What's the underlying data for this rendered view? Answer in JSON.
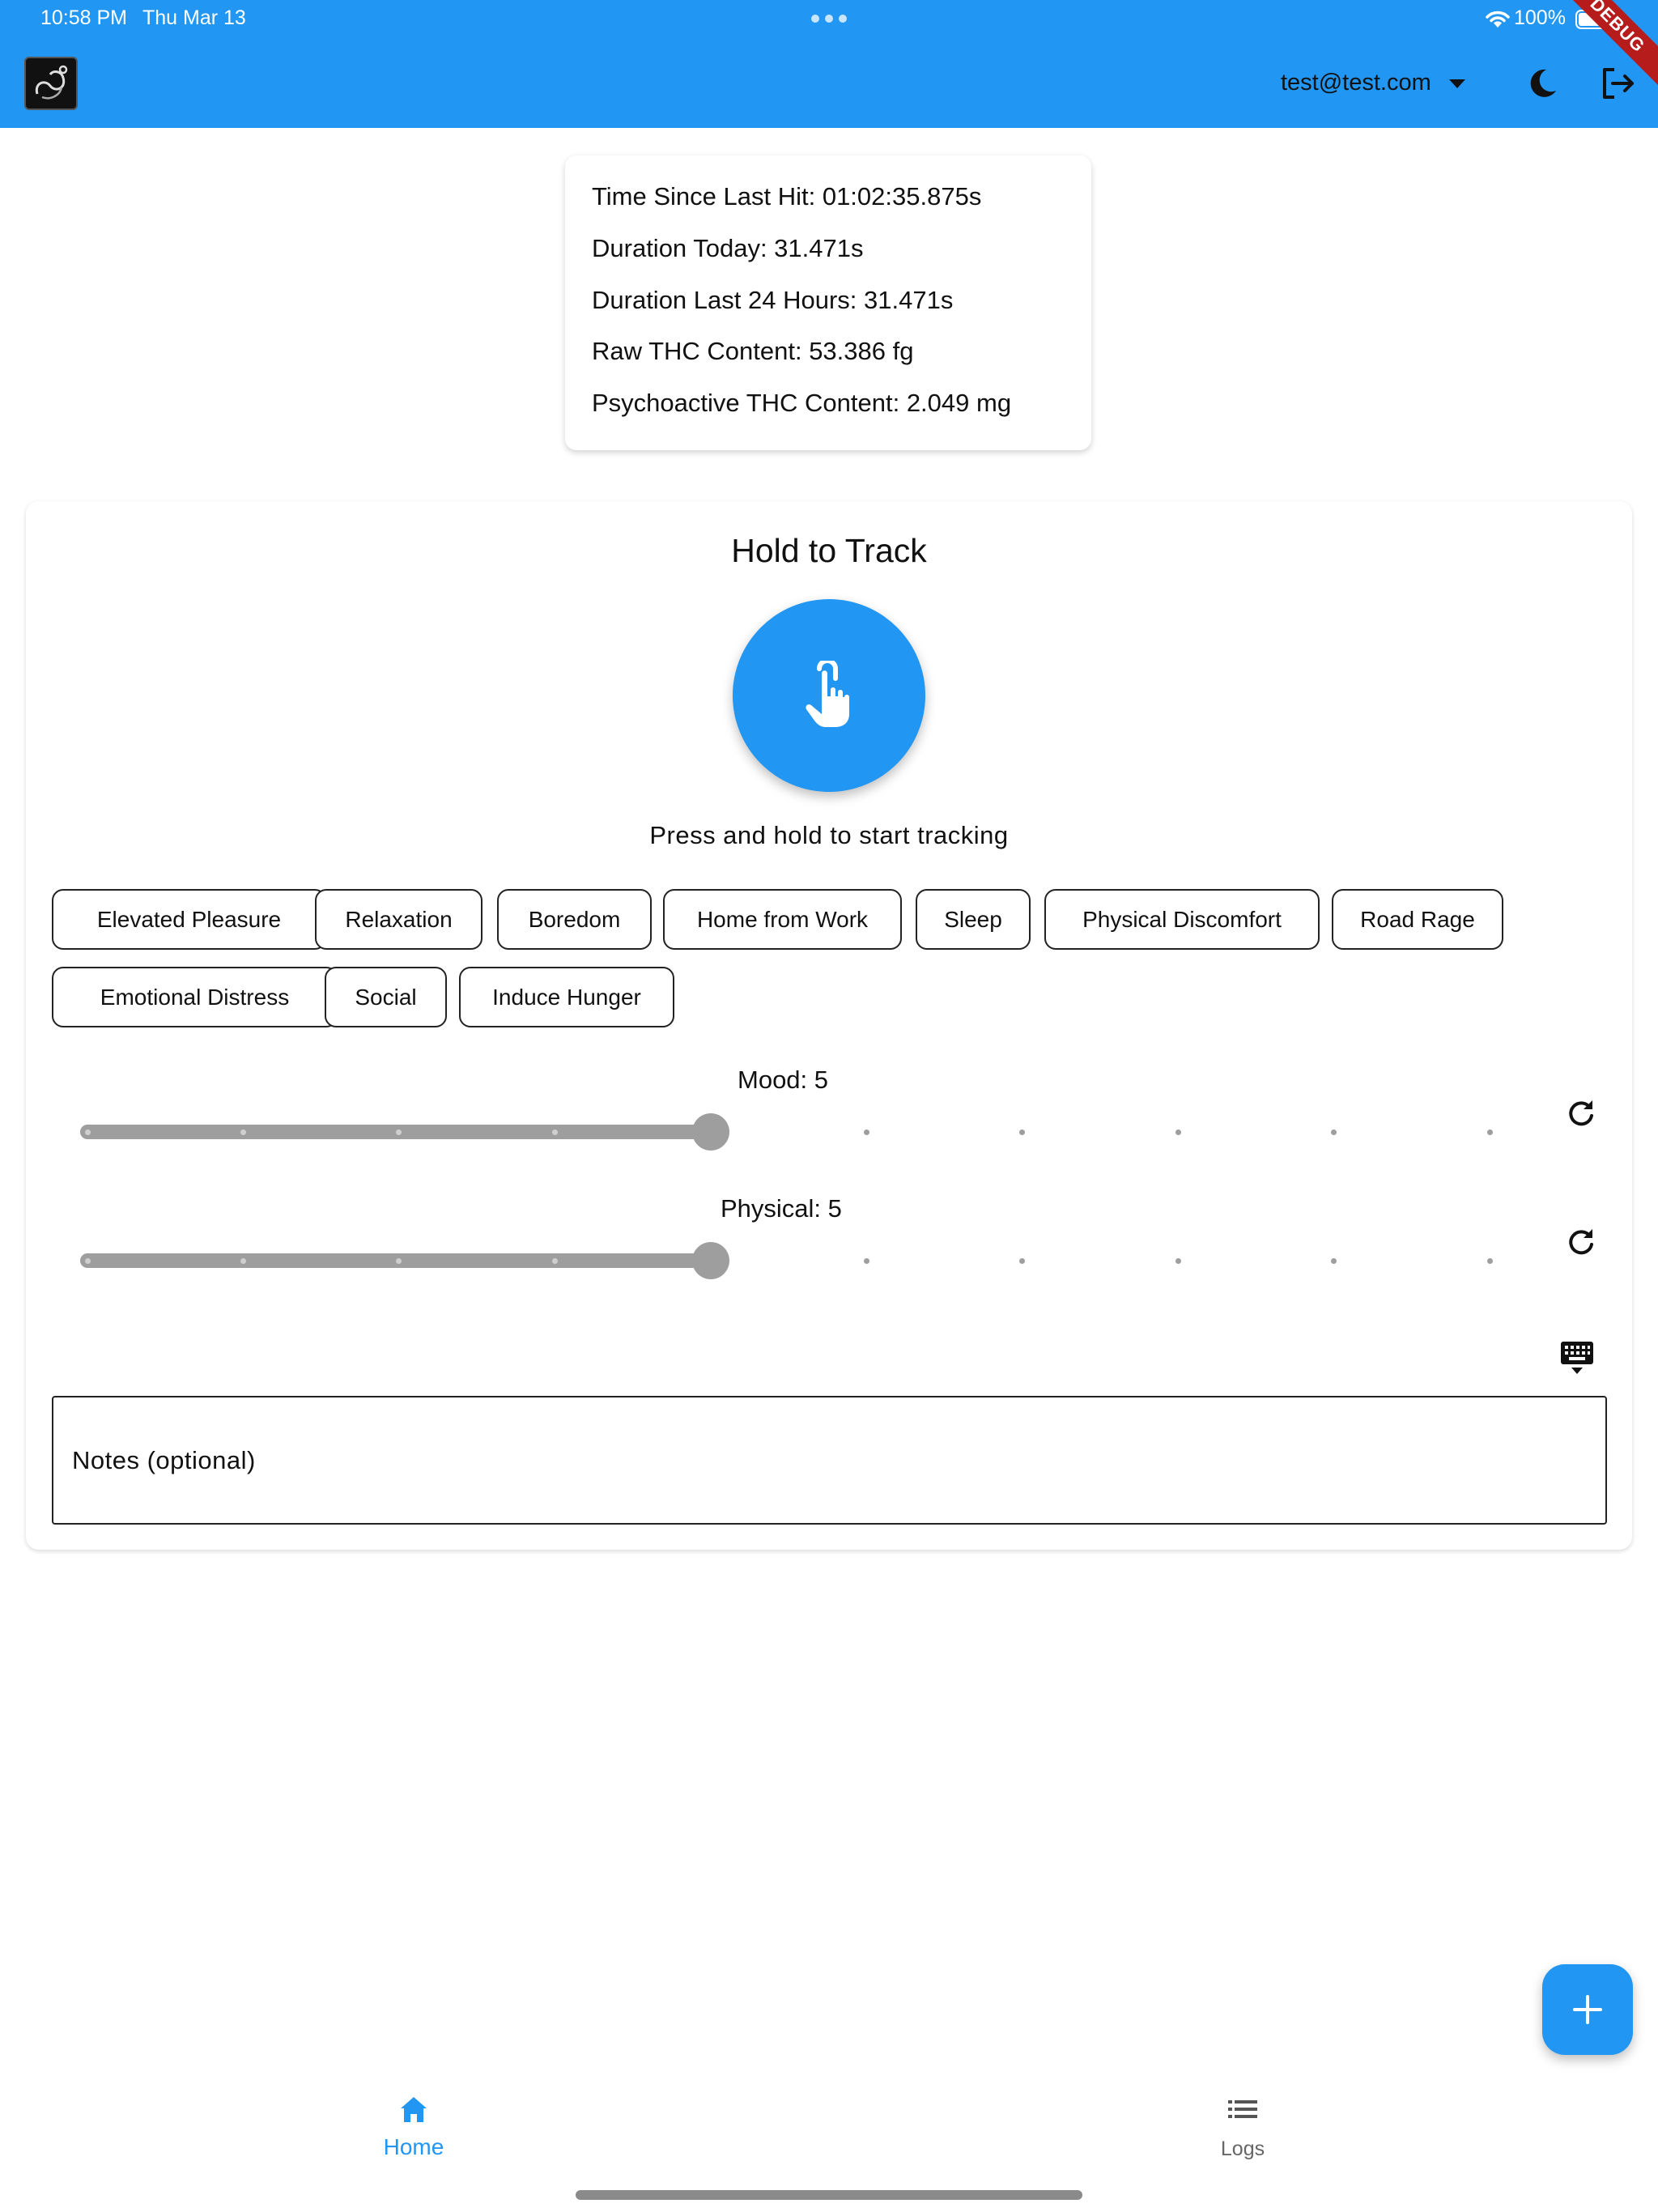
{
  "status_bar": {
    "time": "10:58 PM",
    "date": "Thu Mar 13",
    "battery": "100%",
    "debug_label": "DEBUG"
  },
  "app_bar": {
    "user_email": "test@test.com",
    "icons": [
      "app-logo-icon",
      "chevron-down-icon",
      "moon-icon",
      "logout-icon"
    ]
  },
  "stats": {
    "time_since_last_hit": "Time Since Last Hit: 01:02:35.875s",
    "duration_today": "Duration Today: 31.471s",
    "duration_last_24h": "Duration Last 24 Hours: 31.471s",
    "raw_thc": "Raw THC Content: 53.386 fg",
    "psychoactive_thc": "Psychoactive THC Content: 2.049 mg"
  },
  "tracker": {
    "title": "Hold to Track",
    "hint": "Press and hold to start tracking",
    "button_icon": "touch-hand-icon"
  },
  "reasons": [
    "Elevated Pleasure",
    "Relaxation",
    "Boredom",
    "Home from Work",
    "Sleep",
    "Physical Discomfort",
    "Road Rage",
    "Emotional Distress",
    "Social",
    "Induce Hunger"
  ],
  "sliders": {
    "mood": {
      "label": "Mood: 5",
      "value": 5,
      "min": 1,
      "max": 10
    },
    "physical": {
      "label": "Physical: 5",
      "value": 5,
      "min": 1,
      "max": 10
    }
  },
  "notes": {
    "placeholder": "Notes (optional)"
  },
  "bottom_nav": {
    "home": "Home",
    "logs": "Logs"
  },
  "colors": {
    "primary": "#2196F3",
    "slider": "#9e9e9e",
    "debug": "#B71C1C"
  }
}
